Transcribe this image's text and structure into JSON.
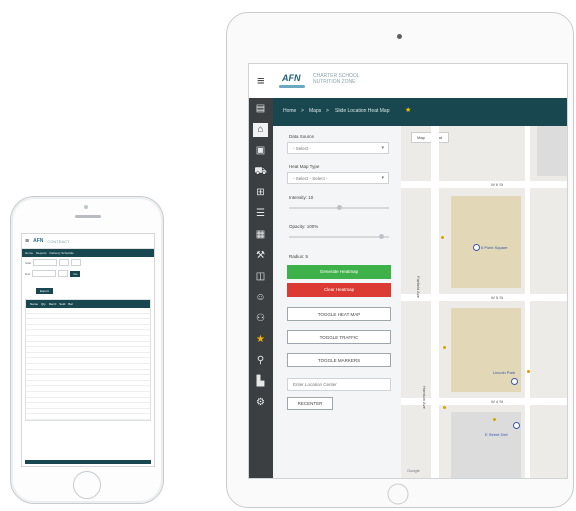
{
  "phone": {
    "logo": "AFN",
    "logo_text": "CONTRACT",
    "nav_items": [
      "Home",
      "Reports",
      "Delivery Schedule"
    ],
    "filter_labels": [
      "Start",
      "End"
    ],
    "go_label": "Go",
    "action_label": "Export",
    "table_headers": [
      "Name",
      "Qty",
      "Rec'd",
      "Sold",
      "Bal"
    ],
    "row_count": 20
  },
  "tablet": {
    "logo": "AFN",
    "logo_text_line1": "CHARTER SCHOOL",
    "logo_text_line2": "NUTRITION ZONE",
    "breadcrumb": {
      "home": "Home",
      "sep1": ">",
      "maps": "Maps",
      "sep2": ">",
      "current": "Slide Location Heat Map",
      "star": "★"
    },
    "panel": {
      "data_source_label": "Data Source",
      "data_source_value": "- Select -",
      "heat_map_type_label": "Heat Map Type",
      "heat_map_type_value": "- Select - Select -",
      "intensity_label": "Intensity: 10",
      "intensity_level": 0.5,
      "opacity_label": "Opacity: 100%",
      "opacity_level": 0.95,
      "radius_label": "Radius: 5",
      "btn_generate": "Generate Heatmap",
      "btn_clear": "Clear Heatmap",
      "btn_toggle_heat": "TOGGLE HEAT MAP",
      "btn_toggle_traffic": "TOGGLE TRAFFIC",
      "btn_toggle_markers": "TOGGLE MARKERS",
      "search_placeholder": "Enter Location Center",
      "btn_recenter": "RECENTER"
    },
    "map": {
      "toggle_map": "Map",
      "toggle_sat": "Sat",
      "streets": [
        "W 6 St",
        "W 5 St",
        "W 4 St",
        "Fairfield Ave",
        "Harrison Ave"
      ],
      "poi": [
        "6 Point Square",
        "Lincoln Park",
        "E Street Deli"
      ],
      "footer": "Google"
    },
    "sidebar_icons": [
      "doc-icon",
      "home-icon",
      "briefcase-icon",
      "truck-icon",
      "cart-icon",
      "list-icon",
      "calendar-icon",
      "wrench-icon",
      "chart-icon",
      "user-icon",
      "people-icon",
      "star-icon",
      "link-icon",
      "bar-chart-icon",
      "settings-icon"
    ]
  }
}
